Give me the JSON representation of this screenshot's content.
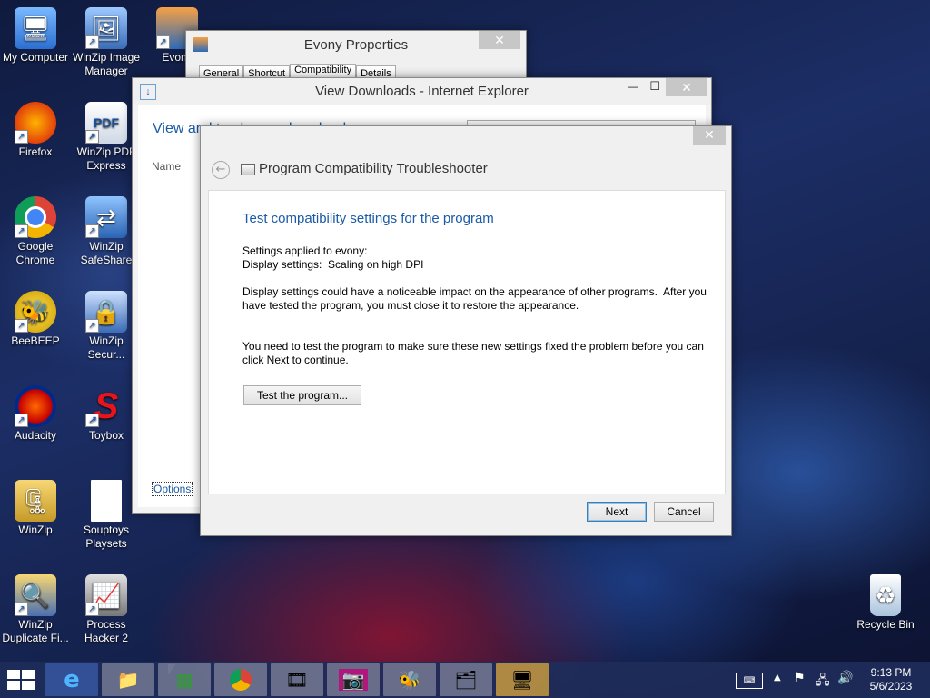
{
  "desktop": {
    "icons": [
      {
        "label": "My Computer"
      },
      {
        "label": "WinZip Image Manager"
      },
      {
        "label": "Evony"
      },
      {
        "label": "Firefox"
      },
      {
        "label": "WinZip PDF Express"
      },
      {
        "label": "Google Chrome"
      },
      {
        "label": "WinZip SafeShare"
      },
      {
        "label": "BeeBEEP"
      },
      {
        "label": "WinZip Secur..."
      },
      {
        "label": "Audacity"
      },
      {
        "label": "Toybox"
      },
      {
        "label": "WinZip"
      },
      {
        "label": "Souptoys Playsets"
      },
      {
        "label": "WinZip Duplicate Fi..."
      },
      {
        "label": "Process Hacker 2"
      },
      {
        "label": "Recycle Bin"
      }
    ]
  },
  "evony_window": {
    "title": "Evony Properties",
    "tabs": [
      "General",
      "Shortcut",
      "Compatibility",
      "Details"
    ],
    "close": "✕"
  },
  "ie_window": {
    "title": "View Downloads - Internet Explorer",
    "heading": "View and track your downloads",
    "column_name": "Name",
    "options_link": "Options",
    "minimize": "—",
    "maximize": "☐",
    "close": "✕"
  },
  "troubleshooter": {
    "title": "Program Compatibility Troubleshooter",
    "close": "✕",
    "heading": "Test compatibility settings for the program",
    "settings_line1": "Settings applied to evony:",
    "settings_line2": "Display settings:  Scaling on high DPI",
    "para1": "Display settings could have a noticeable impact on the appearance of other programs.  After you have tested the program, you must close it to restore the appearance.",
    "para2": "You need to test the program to make sure these new settings fixed the problem before you can click Next to continue.",
    "test_button": "Test the program...",
    "next_button": "Next",
    "cancel_button": "Cancel"
  },
  "taskbar": {
    "time": "9:13 PM",
    "date": "5/6/2023"
  },
  "colors": {
    "accent_blue": "#1e5aa0",
    "heading_blue": "#1a5aa6",
    "taskbar": "#1e2d5a"
  }
}
